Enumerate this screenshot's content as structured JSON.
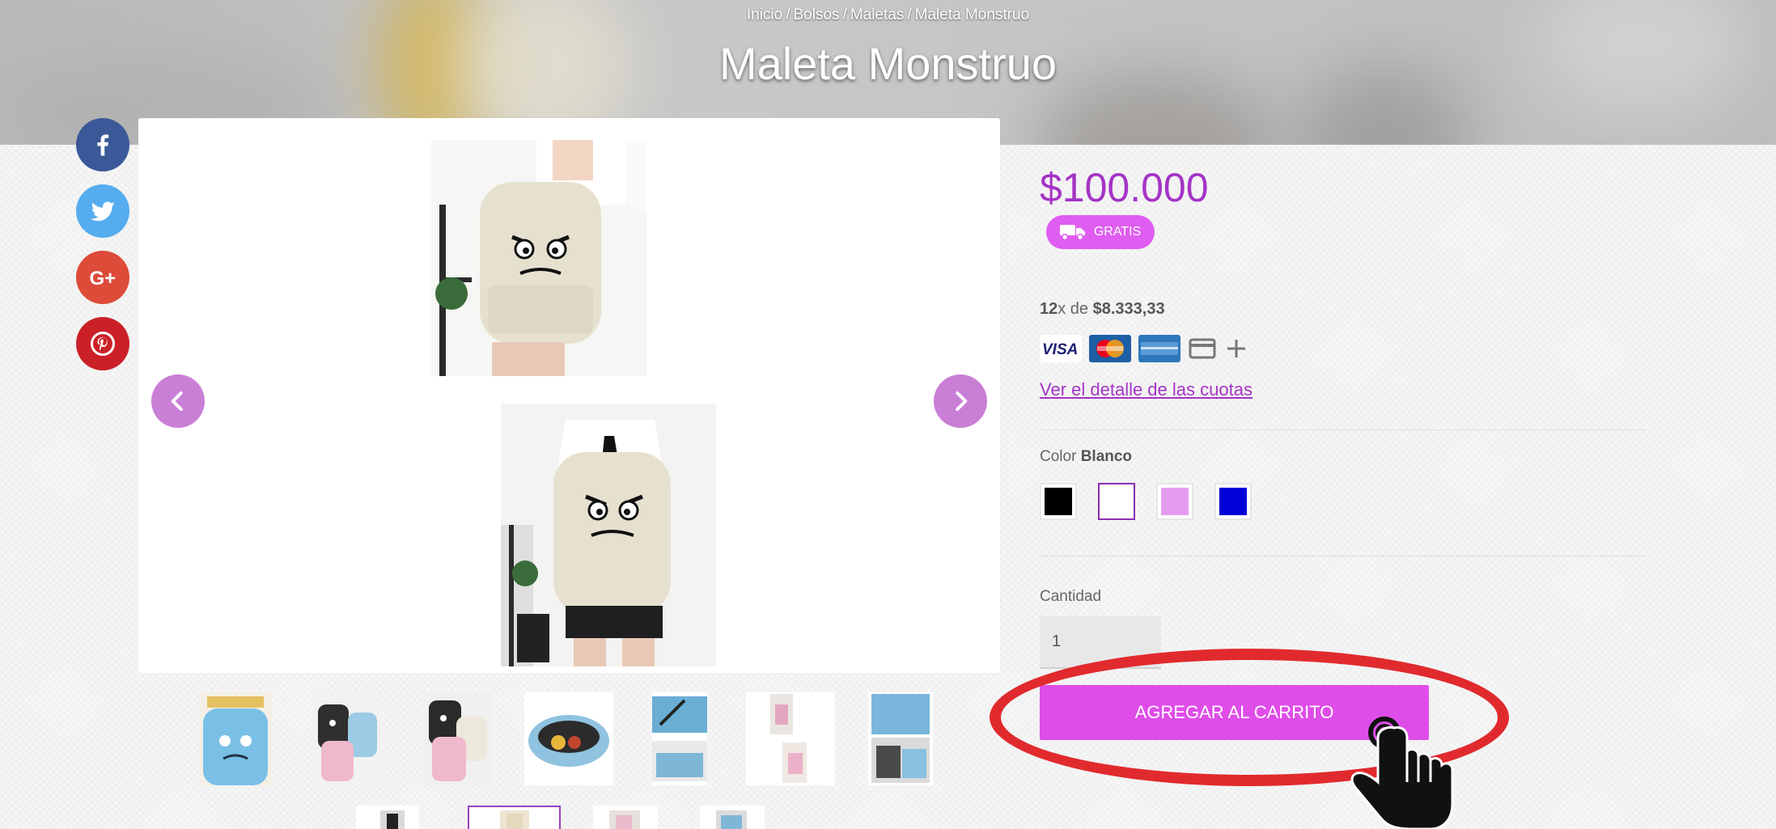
{
  "breadcrumb": {
    "items": [
      "Inicio",
      "Bolsos",
      "Maletas",
      "Maleta Monstruo"
    ],
    "separator": "/"
  },
  "product": {
    "title": "Maleta Monstruo",
    "price": "$100.000",
    "shipping_badge": "GRATIS",
    "installments": {
      "count": "12",
      "connector": "x de",
      "amount": "$8.333,33"
    },
    "payment_cards": [
      "VISA",
      "MasterCard",
      "American Express",
      "credit-card-icon",
      "plus-icon"
    ],
    "installments_link": "Ver el detalle de las cuotas",
    "color": {
      "label": "Color",
      "selected": "Blanco",
      "options": [
        {
          "name": "Negro",
          "hex": "#000000"
        },
        {
          "name": "Blanco",
          "hex": "#ffffff"
        },
        {
          "name": "Rosa",
          "hex": "#e59cf0"
        },
        {
          "name": "Azul",
          "hex": "#0000d8"
        }
      ]
    },
    "quantity": {
      "label": "Cantidad",
      "value": "1"
    },
    "add_to_cart": "AGREGAR AL CARRITO"
  },
  "share": [
    "facebook-icon",
    "twitter-icon",
    "google-plus-icon",
    "pinterest-icon"
  ],
  "thumbnails_count": 11,
  "active_thumbnail": 8,
  "colors": {
    "accent": "#a534c6",
    "button": "#df4de9",
    "annotation": "#e12a2e"
  }
}
